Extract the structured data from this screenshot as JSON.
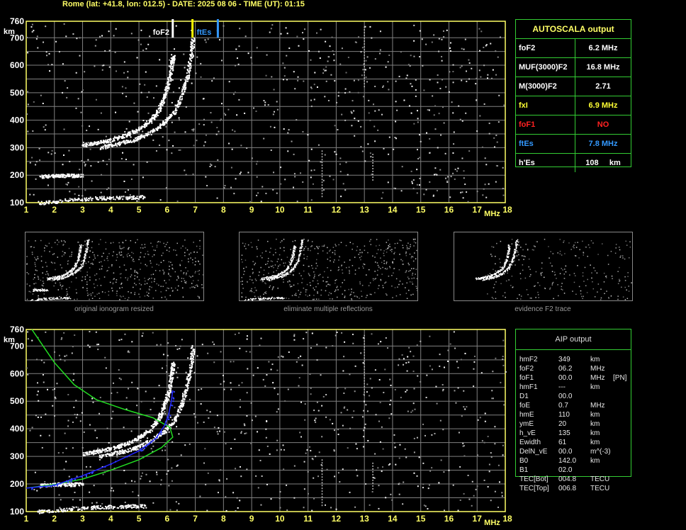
{
  "header": {
    "title": "Rome (lat: +41.8, lon: 012.5) - DATE: 2025 08 06 - TIME (UT): 01:15"
  },
  "colors": {
    "grid": "#808080",
    "axis": "#ffff66",
    "panel_border": "#33cc33",
    "fof2_marker": "#ffffff",
    "fxl_marker": "#ffff00",
    "ftes_marker": "#3399ff",
    "aip_profile": "#2222ff",
    "model_profile": "#22dd22"
  },
  "chart_data": [
    {
      "type": "scatter",
      "title": "",
      "xlabel": "MHz",
      "ylabel": "km",
      "xlim": [
        1,
        18
      ],
      "ylim": [
        100,
        760
      ],
      "x_ticks": [
        "1",
        "2",
        "3",
        "4",
        "5",
        "6",
        "7",
        "8",
        "9",
        "10",
        "11",
        "12",
        "13",
        "14",
        "15",
        "16",
        "17",
        "18"
      ],
      "y_ticks": [
        "760",
        "700",
        "600",
        "500",
        "400",
        "300",
        "200",
        "100"
      ],
      "grid": true,
      "markers": [
        {
          "name": "foF2",
          "x": 6.2,
          "color": "#ffffff"
        },
        {
          "name": "fxI",
          "x": 6.9,
          "color": "#ffff00"
        },
        {
          "name": "ftEs",
          "x": 7.8,
          "color": "#3399ff"
        }
      ],
      "traces": [
        {
          "name": "F2 ordinary",
          "points": [
            [
              3.0,
              310
            ],
            [
              3.5,
              320
            ],
            [
              4.0,
              330
            ],
            [
              4.5,
              345
            ],
            [
              5.0,
              370
            ],
            [
              5.4,
              400
            ],
            [
              5.7,
              440
            ],
            [
              5.9,
              490
            ],
            [
              6.05,
              540
            ],
            [
              6.15,
              600
            ],
            [
              6.2,
              640
            ]
          ]
        },
        {
          "name": "F2 extraordinary",
          "points": [
            [
              3.6,
              302
            ],
            [
              4.2,
              315
            ],
            [
              4.8,
              330
            ],
            [
              5.3,
              352
            ],
            [
              5.8,
              385
            ],
            [
              6.2,
              425
            ],
            [
              6.5,
              490
            ],
            [
              6.7,
              560
            ],
            [
              6.85,
              640
            ],
            [
              6.9,
              700
            ]
          ]
        },
        {
          "name": "Es",
          "points": [
            [
              1.4,
              100
            ],
            [
              2.5,
              110
            ],
            [
              3.5,
              118
            ],
            [
              4.5,
              120
            ],
            [
              5.2,
              122
            ]
          ]
        },
        {
          "name": "Es multiple",
          "points": [
            [
              1.5,
              197
            ],
            [
              2.0,
              200
            ],
            [
              2.5,
              200
            ],
            [
              3.0,
              200
            ]
          ]
        }
      ]
    },
    {
      "type": "line",
      "title": "",
      "xlabel": "MHz",
      "ylabel": "km",
      "xlim": [
        1,
        18
      ],
      "ylim": [
        100,
        760
      ],
      "x_ticks": [
        "1",
        "2",
        "3",
        "4",
        "5",
        "6",
        "7",
        "8",
        "9",
        "10",
        "11",
        "12",
        "13",
        "14",
        "15",
        "16",
        "17",
        "18"
      ],
      "y_ticks": [
        "760",
        "700",
        "600",
        "500",
        "400",
        "300",
        "200",
        "100"
      ],
      "grid": true,
      "series": [
        {
          "values": [
            [
              1.0,
              185
            ],
            [
              2.0,
              195
            ],
            [
              3.0,
              230
            ],
            [
              4.0,
              272
            ],
            [
              5.0,
              320
            ],
            [
              5.6,
              365
            ],
            [
              5.9,
              410
            ],
            [
              6.05,
              450
            ],
            [
              6.15,
              500
            ],
            [
              6.2,
              540
            ]
          ]
        },
        {
          "values": [
            [
              1.0,
              185
            ],
            [
              2.0,
              198
            ],
            [
              3.0,
              218
            ],
            [
              4.0,
              250
            ],
            [
              5.0,
              288
            ],
            [
              5.8,
              332
            ],
            [
              6.2,
              370
            ],
            [
              6.1,
              405
            ],
            [
              5.5,
              440
            ],
            [
              4.5,
              470
            ],
            [
              3.5,
              505
            ],
            [
              2.7,
              560
            ],
            [
              2.0,
              640
            ],
            [
              1.6,
              700
            ],
            [
              1.2,
              760
            ]
          ]
        }
      ]
    }
  ],
  "autoscala": {
    "title": "AUTOSCALA output",
    "rows": [
      {
        "name": "foF2",
        "value": "6.2 MHz",
        "color": "#ffffff"
      },
      {
        "name": "MUF(3000)F2",
        "value": "16.8 MHz",
        "color": "#ffffff"
      },
      {
        "name": "M(3000)F2",
        "value": "2.71",
        "color": "#ffffff"
      },
      {
        "name": "fxI",
        "value": "6.9 MHz",
        "color": "#ffff33"
      },
      {
        "name": "foF1",
        "value": "NO",
        "color": "#ff2222"
      },
      {
        "name": "ftEs",
        "value": "7.8 MHz",
        "color": "#3399ff"
      },
      {
        "name": "h'Es",
        "value": "108     km",
        "color": "#ffffff"
      }
    ]
  },
  "thumbnails": [
    {
      "caption": "original ionogram resized"
    },
    {
      "caption": "eliminate multiple reflections"
    },
    {
      "caption": "evidence F2 trace"
    }
  ],
  "aip": {
    "title": "AIP output",
    "rows": [
      {
        "name": "hmF2",
        "value": "349",
        "unit": "km",
        "extra": ""
      },
      {
        "name": "foF2",
        "value": "06.2",
        "unit": "MHz",
        "extra": ""
      },
      {
        "name": "foF1",
        "value": "00.0",
        "unit": "MHz",
        "extra": "[PN]"
      },
      {
        "name": "hmF1",
        "value": "---",
        "unit": "km",
        "extra": ""
      },
      {
        "name": "D1",
        "value": "00.0",
        "unit": "",
        "extra": ""
      },
      {
        "name": "foE",
        "value": "0.7",
        "unit": "MHz",
        "extra": ""
      },
      {
        "name": "hmE",
        "value": "110",
        "unit": "km",
        "extra": ""
      },
      {
        "name": "ymE",
        "value": "20",
        "unit": "km",
        "extra": ""
      },
      {
        "name": "h_vE",
        "value": "135",
        "unit": "km",
        "extra": ""
      },
      {
        "name": "Ewidth",
        "value": "61",
        "unit": "km",
        "extra": ""
      },
      {
        "name": "DelN_vE",
        "value": "00.0",
        "unit": "m^(-3)",
        "extra": ""
      },
      {
        "name": "B0",
        "value": "142.0",
        "unit": "km",
        "extra": ""
      },
      {
        "name": "B1",
        "value": "02.0",
        "unit": "",
        "extra": ""
      },
      {
        "name": "TEC[Bot]",
        "value": "004.8",
        "unit": "TECU",
        "extra": ""
      },
      {
        "name": "TEC[Top]",
        "value": "006.8",
        "unit": "TECU",
        "extra": ""
      }
    ]
  }
}
